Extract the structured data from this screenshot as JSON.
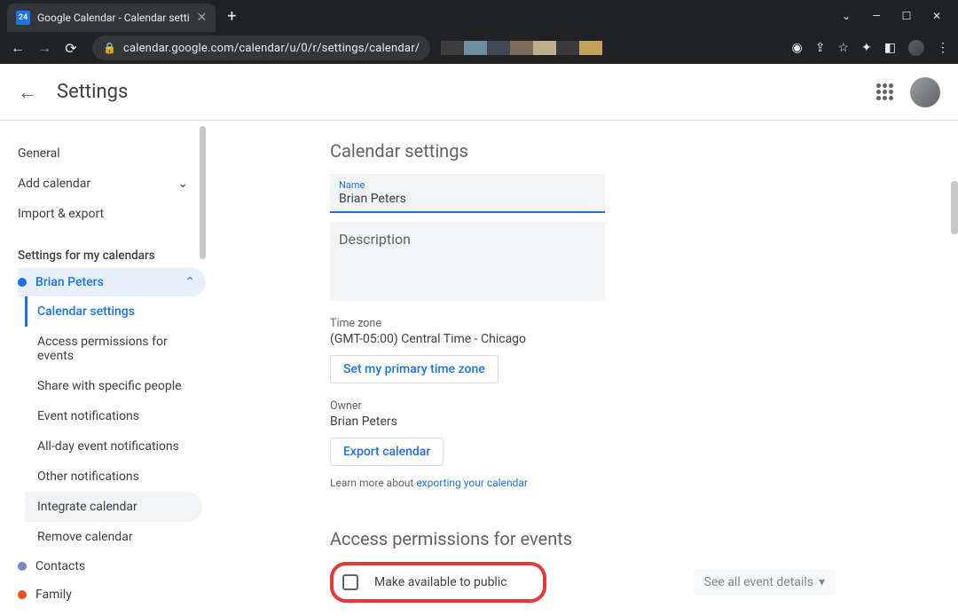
{
  "browser": {
    "tab_title": "Google Calendar - Calendar setti",
    "url": "calendar.google.com/calendar/u/0/r/settings/calendar/"
  },
  "header": {
    "title": "Settings"
  },
  "sidebar": {
    "general": "General",
    "add_calendar": "Add calendar",
    "import_export": "Import & export",
    "section_header": "Settings for my calendars",
    "active_calendar": "Brian Peters",
    "subitems": {
      "calendar_settings": "Calendar settings",
      "access_permissions": "Access permissions for events",
      "share": "Share with specific people",
      "event_notifications": "Event notifications",
      "allday_notifications": "All-day event notifications",
      "other_notifications": "Other notifications",
      "integrate": "Integrate calendar",
      "remove": "Remove calendar"
    },
    "contacts": "Contacts",
    "family": "Family"
  },
  "main": {
    "section_title": "Calendar settings",
    "name_label": "Name",
    "name_value": "Brian Peters",
    "description_label": "Description",
    "timezone_label": "Time zone",
    "timezone_value": "(GMT-05:00) Central Time - Chicago",
    "set_primary_tz": "Set my primary time zone",
    "owner_label": "Owner",
    "owner_value": "Brian Peters",
    "export_btn": "Export calendar",
    "learn_prefix": "Learn more about ",
    "learn_link": "exporting your calendar",
    "access_title": "Access permissions for events",
    "public_label": "Make available to public",
    "see_all": "See all event details"
  }
}
